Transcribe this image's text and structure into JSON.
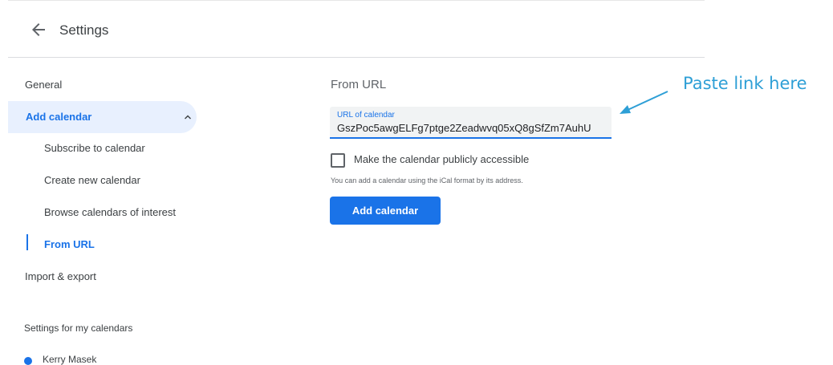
{
  "header": {
    "back_icon": "arrow-left-icon",
    "title": "Settings"
  },
  "sidebar": {
    "general": "General",
    "add_calendar": "Add calendar",
    "chevron_icon": "chevron-up-icon",
    "sub_items": [
      "Subscribe to calendar",
      "Create new calendar",
      "Browse calendars of interest",
      "From URL"
    ],
    "import_export": "Import & export",
    "my_calendars_heading": "Settings for my calendars",
    "calendars": [
      {
        "name": "Kerry Masek",
        "color": "#1a73e8"
      }
    ]
  },
  "main": {
    "title": "From URL",
    "url_field": {
      "label": "URL of calendar",
      "value": "GszPoc5awgELFg7ptge2Zeadwvq05xQ8gSfZm7AuhU"
    },
    "public_checkbox_label": "Make the calendar publicly accessible",
    "public_checkbox_checked": false,
    "helper_text": "You can add a calendar using the iCal format by its address.",
    "add_button_label": "Add calendar"
  },
  "annotation": {
    "text": "Paste link here",
    "color": "#2e9fd6"
  },
  "colors": {
    "accent": "#1a73e8",
    "active_bg": "#e8f0fe"
  }
}
